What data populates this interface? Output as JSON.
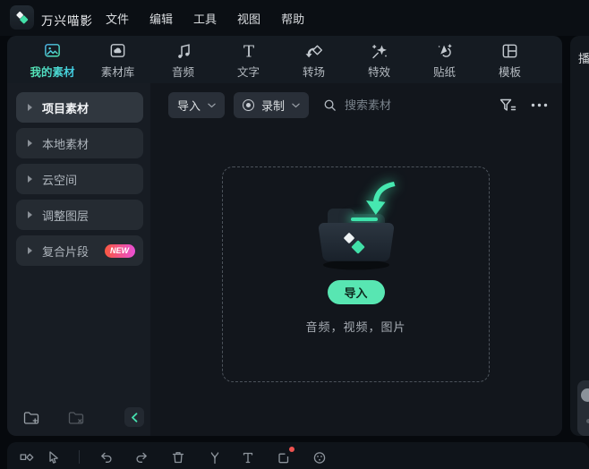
{
  "window": {
    "app_title": "万兴喵影",
    "menus": [
      "文件",
      "编辑",
      "工具",
      "视图",
      "帮助"
    ]
  },
  "tabs": [
    {
      "label": "我的素材",
      "icon": "my-media-icon",
      "active": true
    },
    {
      "label": "素材库",
      "icon": "stock-media-icon",
      "active": false
    },
    {
      "label": "音频",
      "icon": "audio-icon",
      "active": false
    },
    {
      "label": "文字",
      "icon": "text-icon",
      "active": false
    },
    {
      "label": "转场",
      "icon": "transition-icon",
      "active": false
    },
    {
      "label": "特效",
      "icon": "effects-icon",
      "active": false
    },
    {
      "label": "贴纸",
      "icon": "sticker-icon",
      "active": false
    },
    {
      "label": "模板",
      "icon": "template-icon",
      "active": false
    }
  ],
  "sidebar": {
    "items": [
      {
        "label": "项目素材",
        "active": true
      },
      {
        "label": "本地素材",
        "active": false
      },
      {
        "label": "云空间",
        "active": false
      },
      {
        "label": "调整图层",
        "active": false
      },
      {
        "label": "复合片段",
        "active": false,
        "badge": "NEW"
      }
    ],
    "footer_icons": [
      "folder-plus-icon",
      "folder-delete-icon",
      "collapse-panel-icon"
    ]
  },
  "toolbar": {
    "import_label": "导入",
    "record_label": "录制",
    "search_placeholder": "搜索素材",
    "right_icons": [
      "filter-icon",
      "more-icon"
    ]
  },
  "dropzone": {
    "import_label": "导入",
    "caption": "音频，视频，图片"
  },
  "right_panel": {
    "title": "播"
  },
  "timeline_toolbar": {
    "icons": [
      "track-manager-icon",
      "pointer-icon",
      "undo-icon",
      "redo-icon",
      "trash-icon",
      "split-icon",
      "text-tool-icon",
      "frame-record-icon",
      "color-wheel-icon"
    ]
  },
  "colors": {
    "accent_teal": "#58e6b2",
    "tab_gradient": [
      "#57e7b2",
      "#41c9e2"
    ],
    "badge_gradient": [
      "#f9583f",
      "#e94fd6"
    ],
    "record_red": "#ef5350",
    "panel_bg": "#12161c"
  }
}
